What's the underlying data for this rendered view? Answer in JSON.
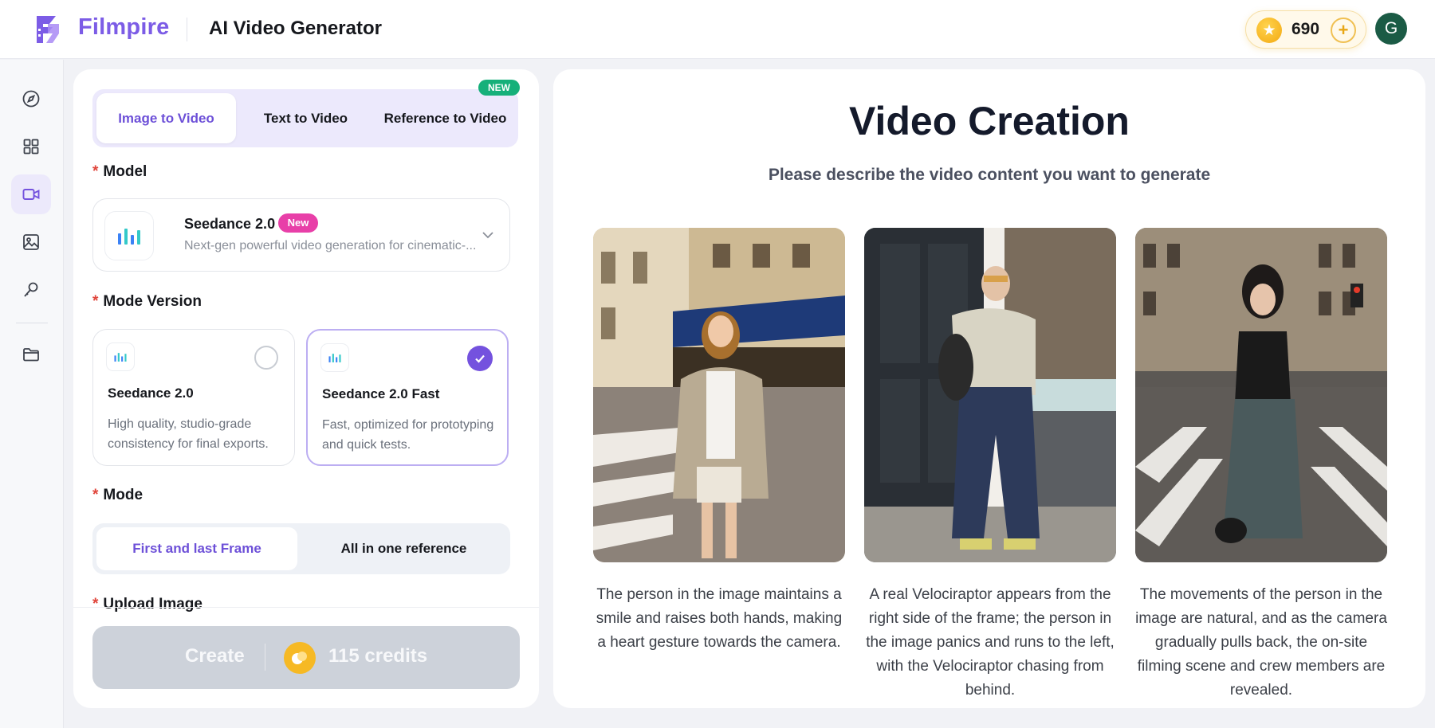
{
  "header": {
    "brand": "Filmpire",
    "title": "AI Video Generator",
    "credits": "690",
    "avatar_initial": "G"
  },
  "sidebar": {
    "items": [
      {
        "icon": "compass-icon",
        "active": false
      },
      {
        "icon": "grid-icon",
        "active": false
      },
      {
        "icon": "video-camera-icon",
        "active": true
      },
      {
        "icon": "image-icon",
        "active": false
      },
      {
        "icon": "microphone-icon",
        "active": false
      },
      {
        "icon": "folder-icon",
        "active": false
      }
    ]
  },
  "left_panel": {
    "tabs": [
      {
        "label": "Image to Video",
        "active": true
      },
      {
        "label": "Text to Video",
        "active": false
      },
      {
        "label": "Reference to Video",
        "active": false
      }
    ],
    "tabs_badge": "NEW",
    "model_label": "Model",
    "model": {
      "name": "Seedance 2.0",
      "badge": "New",
      "description": "Next-gen powerful video generation for cinematic-..."
    },
    "mode_version_label": "Mode Version",
    "versions": [
      {
        "name": "Seedance 2.0",
        "description": "High quality, studio-grade consistency for final exports.",
        "selected": false
      },
      {
        "name": "Seedance 2.0 Fast",
        "description": "Fast, optimized for prototyping and quick tests.",
        "selected": true
      }
    ],
    "mode_label": "Mode",
    "modes": [
      {
        "label": "First and last Frame",
        "active": true
      },
      {
        "label": "All in one reference",
        "active": false
      }
    ],
    "upload_label": "Upload Image",
    "create": {
      "label": "Create",
      "credits": "115 credits"
    }
  },
  "right_panel": {
    "title": "Video Creation",
    "subtitle": "Please describe the video content you want to generate",
    "examples": [
      {
        "caption": "The person in the image maintains a smile and raises both hands, making a heart gesture towards the camera."
      },
      {
        "caption": "A real Velociraptor appears from the right side of the frame; the person in the image panics and runs to the left, with the Velociraptor chasing from behind."
      },
      {
        "caption": "The movements of the person in the image are natural, and as the camera gradually pulls back, the on-site filming scene and crew members are revealed."
      }
    ]
  },
  "colors": {
    "accent": "#7c5ce6",
    "active_tab_text": "#6d50d8",
    "new_badge": "#16b07a",
    "model_badge": "#e83fa8",
    "coin": "#f6b924"
  }
}
